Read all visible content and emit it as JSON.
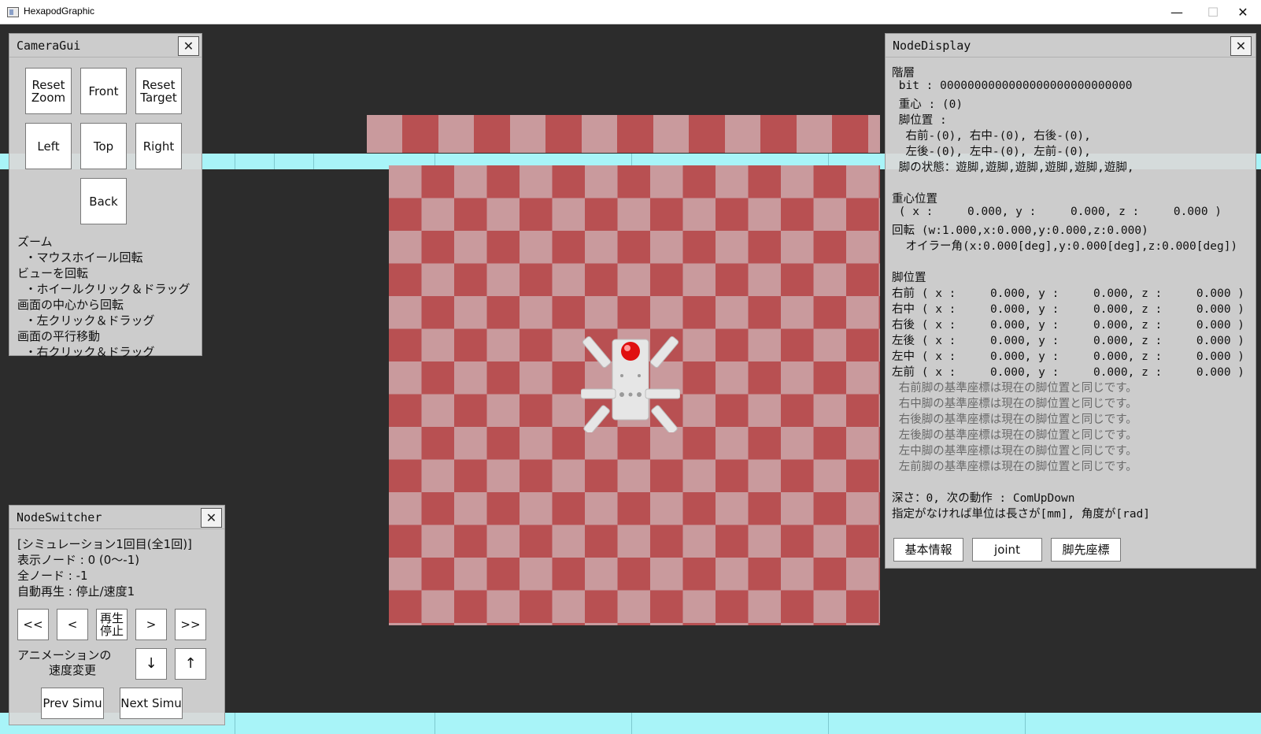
{
  "window": {
    "title": "HexapodGraphic",
    "minimize_glyph": "—",
    "maximize_glyph": "☐",
    "close_glyph": "✕"
  },
  "camera_gui": {
    "title": "CameraGui",
    "close_glyph": "✕",
    "buttons": {
      "reset_zoom": "Reset\nZoom",
      "front": "Front",
      "reset_target": "Reset\nTarget",
      "left": "Left",
      "top": "Top",
      "right": "Right",
      "back": "Back"
    },
    "help": [
      "ズーム",
      "  ・マウスホイール回転",
      "ビューを回転",
      "  ・ホイールクリック＆ドラッグ",
      "画面の中心から回転",
      "  ・左クリック＆ドラッグ",
      "画面の平行移動",
      "  ・右クリック＆ドラッグ"
    ]
  },
  "node_switcher": {
    "title": "NodeSwitcher",
    "close_glyph": "✕",
    "info": [
      "[シミュレーション1回目(全1回)]",
      "表示ノード : 0 (0～-1)",
      "全ノード : -1",
      "自動再生 : 停止/速度1"
    ],
    "buttons": {
      "first": "<<",
      "prev": "<",
      "play_stop": "再生\n停止",
      "next": ">",
      "last": ">>",
      "speed_down": "↓",
      "speed_up": "↑",
      "prev_simu": "Prev Simu",
      "next_simu": "Next Simu"
    },
    "speed_label_1": "アニメーションの",
    "speed_label_2": "速度変更"
  },
  "node_display": {
    "title": "NodeDisplay",
    "close_glyph": "✕",
    "lines": [
      "階層",
      " bit : 0000000000000000000000000000",
      " 重心 : (0)",
      " 脚位置 :",
      "  右前-(0), 右中-(0), 右後-(0),",
      "  左後-(0), 左中-(0), 左前-(0),",
      " 脚の状態：遊脚,遊脚,遊脚,遊脚,遊脚,遊脚,",
      "",
      "重心位置",
      " ( x :     0.000, y :     0.000, z :     0.000 )",
      "回転 (w:1.000,x:0.000,y:0.000,z:0.000)",
      "  オイラー角(x:0.000[deg],y:0.000[deg],z:0.000[deg])",
      "",
      "脚位置",
      "右前 ( x :     0.000, y :     0.000, z :     0.000 )",
      "右中 ( x :     0.000, y :     0.000, z :     0.000 )",
      "右後 ( x :     0.000, y :     0.000, z :     0.000 )",
      "左後 ( x :     0.000, y :     0.000, z :     0.000 )",
      "左中 ( x :     0.000, y :     0.000, z :     0.000 )",
      "左前 ( x :     0.000, y :     0.000, z :     0.000 )"
    ],
    "gray_lines": [
      " 右前脚の基準座標は現在の脚位置と同じです。",
      " 右中脚の基準座標は現在の脚位置と同じです。",
      " 右後脚の基準座標は現在の脚位置と同じです。",
      " 左後脚の基準座標は現在の脚位置と同じです。",
      " 左中脚の基準座標は現在の脚位置と同じです。",
      " 左前脚の基準座標は現在の脚位置と同じです。"
    ],
    "footer": [
      "深さ：0, 次の動作 : ComUpDown",
      "指定がなければ単位は長さが[mm], 角度が[rad]"
    ],
    "tabs": {
      "basic": "基本情報",
      "joint": "joint",
      "foot": "脚先座標"
    }
  },
  "colors": {
    "checker_dark": "#b85052",
    "checker_light": "#c99a9d",
    "floor_strip": "#a8f4f8",
    "panel_bg": "#d8d8d8",
    "com_marker": "#e01010"
  }
}
